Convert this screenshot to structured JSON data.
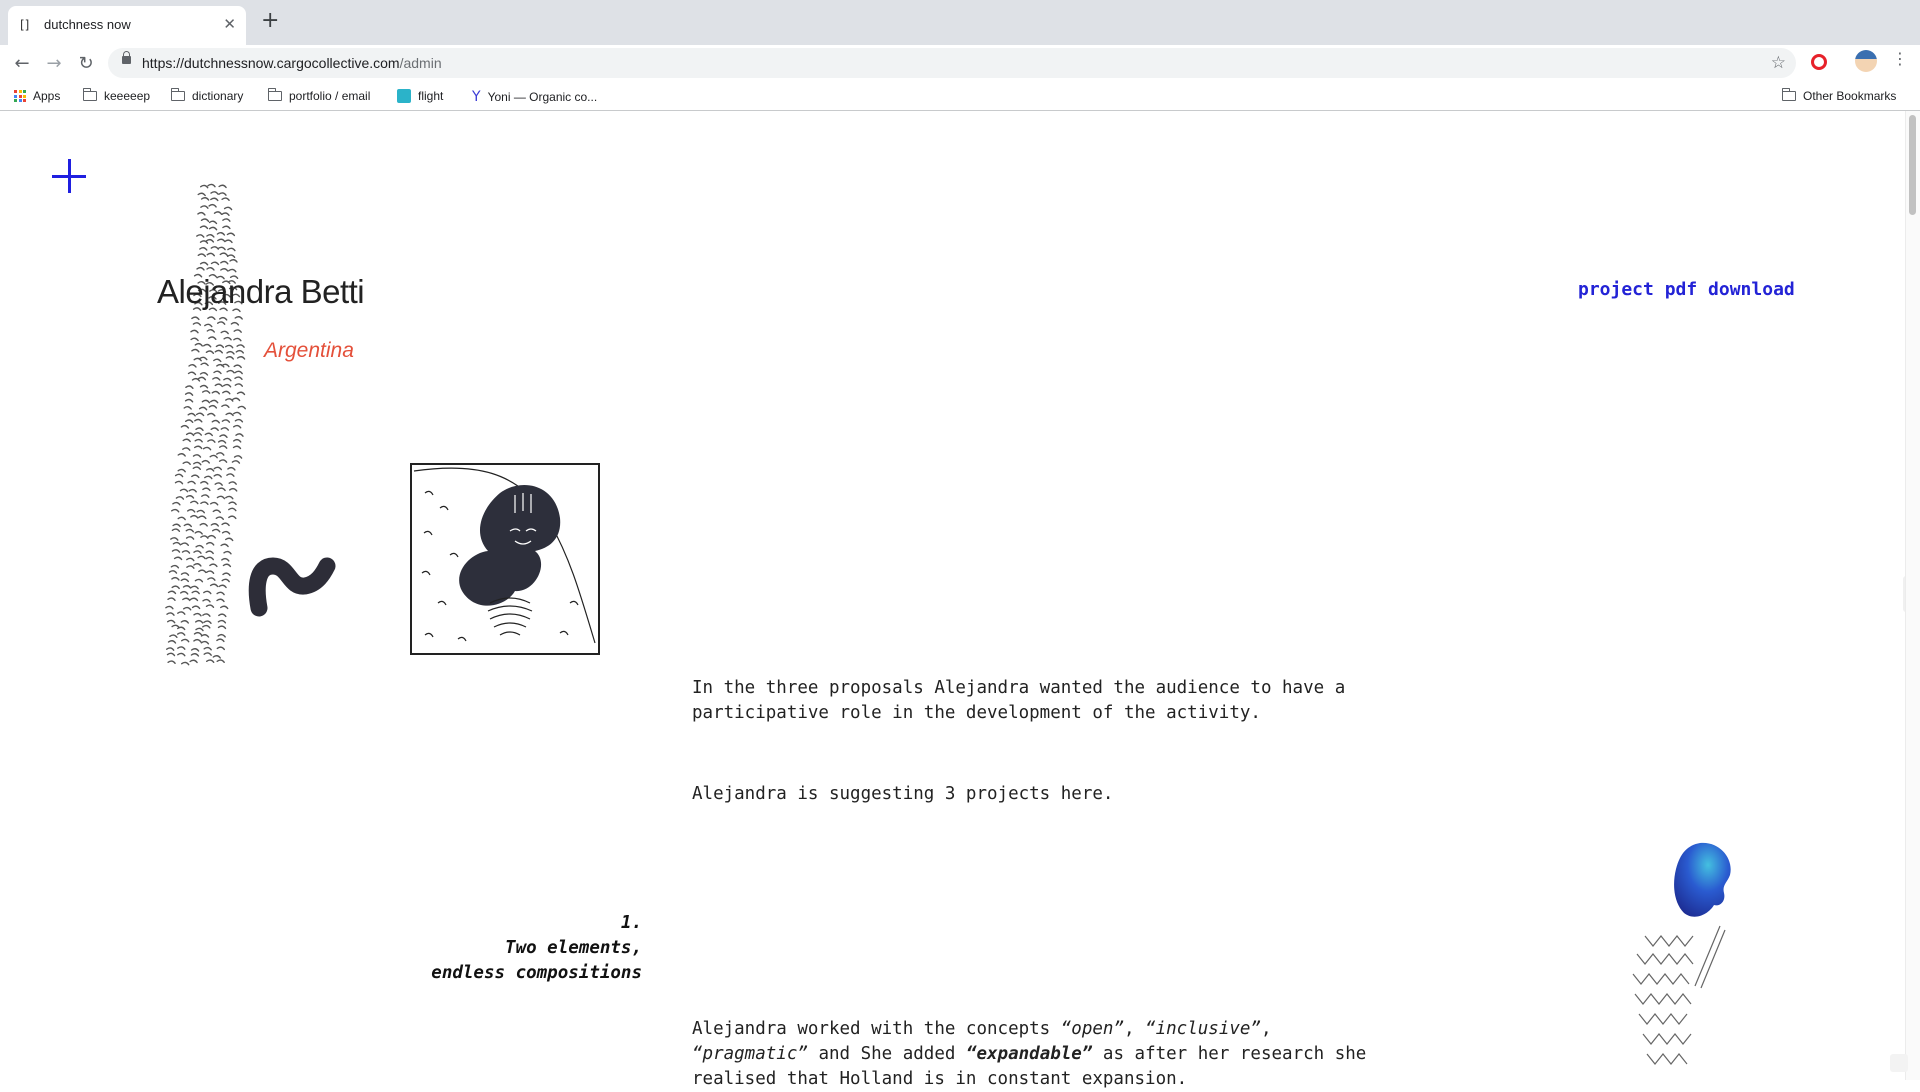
{
  "browser": {
    "tab_title": "dutchness now",
    "new_tab_label": "+",
    "url_host": "https://dutchnessnow.cargocollective.com",
    "url_path": "/admin",
    "bookmarks": [
      {
        "label": "Apps",
        "icon": "apps-grid-icon"
      },
      {
        "label": "keeeeep",
        "icon": "folder-icon"
      },
      {
        "label": "dictionary",
        "icon": "folder-icon"
      },
      {
        "label": "portfolio / email",
        "icon": "folder-icon"
      },
      {
        "label": "flight",
        "icon": "flight-site-icon"
      },
      {
        "label": "Yoni — Organic co...",
        "icon": "y-logo-icon"
      }
    ],
    "other_bookmarks": "Other Bookmarks"
  },
  "page": {
    "artist_name": "Alejandra Betti",
    "country": "Argentina",
    "pdf_link": "project pdf download",
    "intro": "In the three proposals Alejandra wanted the audience to have a participative role in the development of the activity.",
    "suggesting": "Alejandra is suggesting 3 projects here.",
    "project_number": "1.",
    "project_title_line1": "Two elements,",
    "project_title_line2": "endless compositions",
    "concepts_pre": "Alejandra worked with the concepts ",
    "concept_open": "“open”",
    "comma1": ", ",
    "concept_inclusive": "“inclusive”",
    "comma2": ",",
    "concept_pragmatic": "“pragmatic”",
    "and_she_added": " and She added ",
    "concept_expandable": "“expandable”",
    "after_research": " as after her research she realised that Holland is in constant expansion."
  },
  "colors": {
    "accent_blue": "#2323d6",
    "country_red": "#e4503a",
    "ink": "#222222"
  }
}
